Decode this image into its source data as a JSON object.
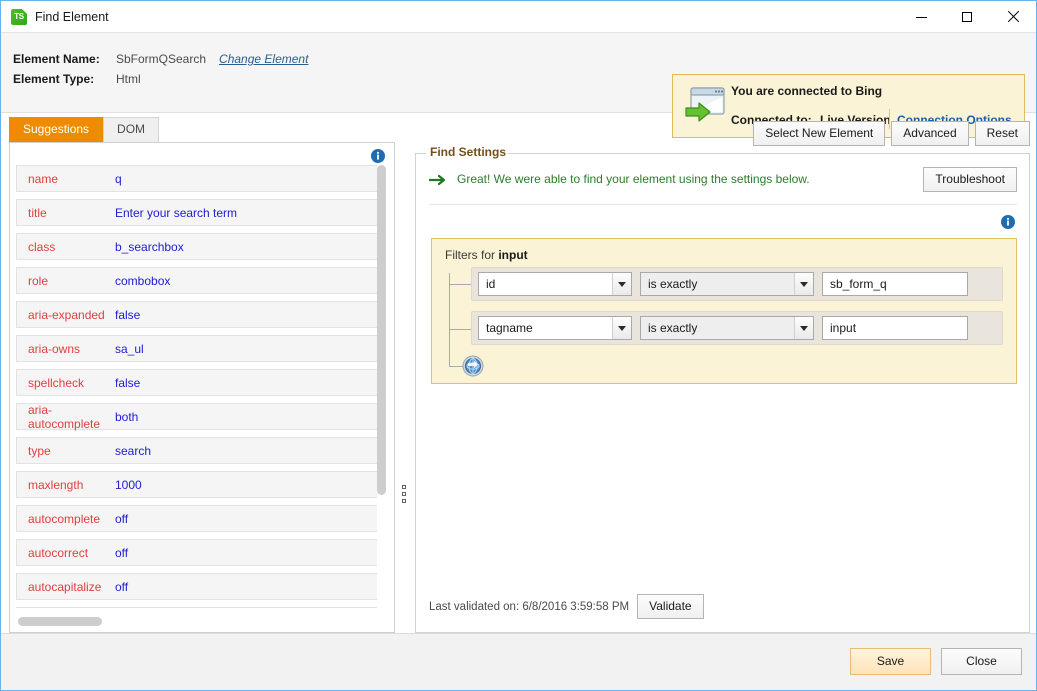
{
  "window": {
    "title": "Find Element",
    "app_icon": "ts-logo-icon",
    "controls": {
      "minimize": "minimize-icon",
      "maximize": "maximize-icon",
      "close": "close-icon"
    }
  },
  "header": {
    "element_name_label": "Element Name:",
    "element_name_value": "SbFormQSearch",
    "change_element_link": "Change Element",
    "element_type_label": "Element Type:",
    "element_type_value": "Html"
  },
  "connection": {
    "icon": "browser-window-arrow-icon",
    "line1": "You are connected to Bing",
    "connected_to_label": "Connected to:",
    "connected_to_value": "Live Version",
    "options_link": "Connection Options"
  },
  "left_panel": {
    "tabs": [
      {
        "label": "Suggestions",
        "active": true
      },
      {
        "label": "DOM",
        "active": false
      }
    ],
    "info_icon": "info-icon",
    "attributes": [
      {
        "name": "name",
        "value": "q"
      },
      {
        "name": "title",
        "value": "Enter your search term"
      },
      {
        "name": "class",
        "value": "b_searchbox"
      },
      {
        "name": "role",
        "value": "combobox"
      },
      {
        "name": "aria-expanded",
        "value": "false"
      },
      {
        "name": "aria-owns",
        "value": "sa_ul"
      },
      {
        "name": "spellcheck",
        "value": "false"
      },
      {
        "name": "aria-autocomplete",
        "value": "both"
      },
      {
        "name": "type",
        "value": "search"
      },
      {
        "name": "maxlength",
        "value": "1000"
      },
      {
        "name": "autocomplete",
        "value": "off"
      },
      {
        "name": "autocorrect",
        "value": "off"
      },
      {
        "name": "autocapitalize",
        "value": "off"
      }
    ]
  },
  "right_panel": {
    "top_buttons": [
      {
        "label": "Select New Element"
      },
      {
        "label": "Advanced"
      },
      {
        "label": "Reset"
      }
    ],
    "group_title": "Find Settings",
    "status_icon": "green-arrow-icon",
    "status_text": "Great! We were able to find your element using the settings below.",
    "troubleshoot_label": "Troubleshoot",
    "info_icon": "info-icon",
    "filters": {
      "title_prefix": "Filters for ",
      "title_target": "input",
      "rows": [
        {
          "attribute": "id",
          "operator": "is exactly",
          "value": "sb_form_q"
        },
        {
          "attribute": "tagname",
          "operator": "is exactly",
          "value": "input"
        }
      ],
      "add_icon": "globe-refresh-icon"
    },
    "validation": {
      "text": "Last validated on: 6/8/2016 3:59:58 PM",
      "button_label": "Validate"
    }
  },
  "footer": {
    "save_label": "Save",
    "close_label": "Close"
  },
  "colors": {
    "accent_orange": "#ee8b00",
    "panel_amber_bg": "#fbf3d5",
    "panel_amber_border": "#e3c267",
    "link_blue": "#1a5fa8",
    "attr_name_red": "#e03f3f",
    "attr_value_blue": "#2020d0",
    "status_green": "#2a7d2a",
    "titlebar_border": "#6ab3e8"
  }
}
